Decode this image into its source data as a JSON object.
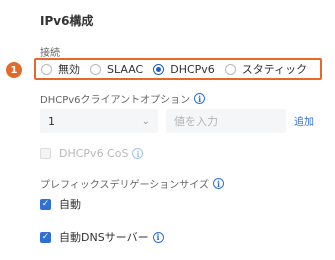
{
  "section_title": "IPv6構成",
  "connection": {
    "label": "接続",
    "badge_number": "1",
    "options": [
      "無効",
      "SLAAC",
      "DHCPv6",
      "スタティック"
    ],
    "selected": "DHCPv6"
  },
  "client_option": {
    "label": "DHCPv6クライアントオプション",
    "select_value": "1",
    "input_placeholder": "値を入力",
    "add_label": "追加"
  },
  "cos": {
    "label": "DHCPv6 CoS",
    "checked": false,
    "disabled": true
  },
  "prefix": {
    "label": "プレフィックスデリゲーションサイズ"
  },
  "auto": {
    "label": "自動",
    "checked": true
  },
  "auto_dns": {
    "label": "自動DNSサーバー",
    "checked": true
  },
  "colors": {
    "accent": "#2f6fd6",
    "highlight": "#e46a2a"
  }
}
